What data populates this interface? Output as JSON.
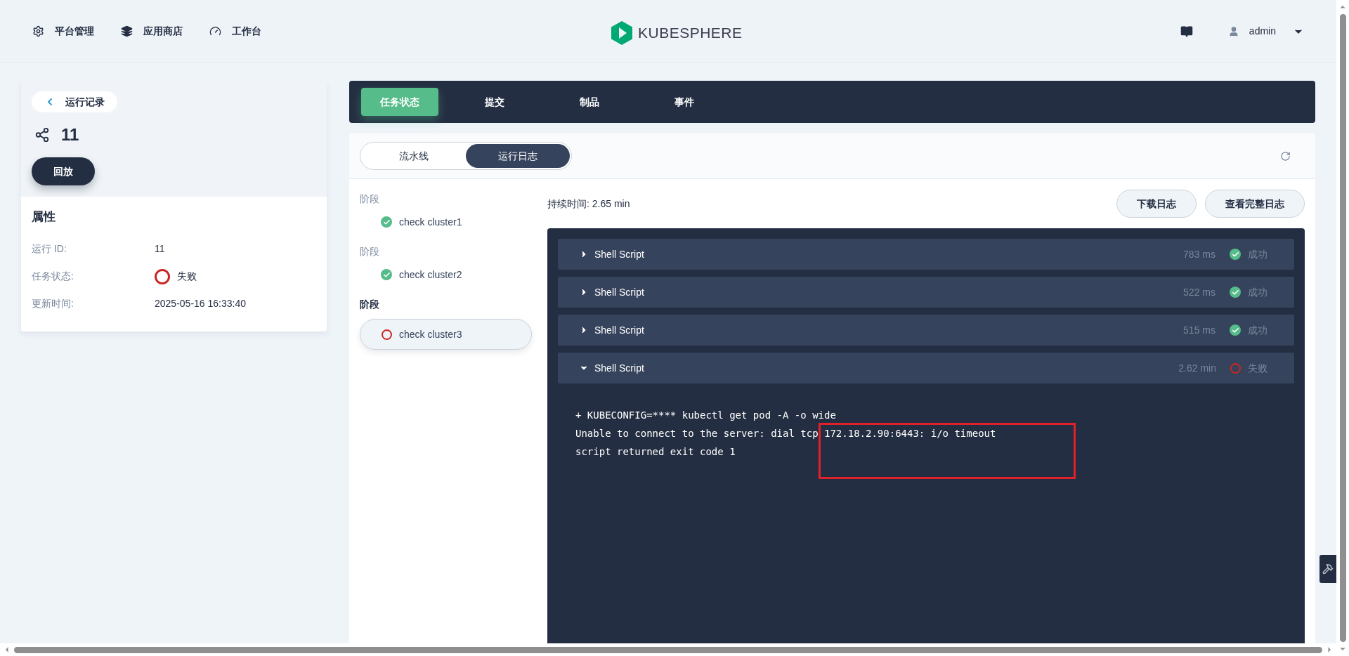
{
  "nav": [
    {
      "label": "平台管理",
      "kind": "gear"
    },
    {
      "label": "应用商店",
      "kind": "layers"
    },
    {
      "label": "工作台",
      "kind": "dial"
    }
  ],
  "logo": {
    "text": "KUBESPHERE"
  },
  "user": {
    "name": "admin"
  },
  "run_card": {
    "back_label": "运行记录",
    "run_number": "11",
    "replay_button": "回放",
    "section_title": "属性",
    "properties": [
      {
        "kind": "text",
        "label": "运行 ID:",
        "value": "11"
      },
      {
        "kind": "status",
        "label": "任务状态:",
        "value": "失败",
        "succeeded": false
      },
      {
        "kind": "text",
        "label": "更新时间:",
        "value": "2025-05-16 16:33:40"
      }
    ]
  },
  "tabs": [
    {
      "label": "任务状态",
      "selected": true
    },
    {
      "label": "提交",
      "selected": false
    },
    {
      "label": "制品",
      "selected": false
    },
    {
      "label": "事件",
      "selected": false
    }
  ],
  "view_toggle": [
    {
      "label": "流水线",
      "selected": false
    },
    {
      "label": "运行日志",
      "selected": true
    }
  ],
  "stages": [
    {
      "label": "阶段",
      "name": "check cluster1",
      "succeeded": true,
      "selected": false
    },
    {
      "label": "阶段",
      "name": "check cluster2",
      "succeeded": true,
      "selected": false
    },
    {
      "label": "阶段",
      "name": "check cluster3",
      "succeeded": false,
      "selected": true
    }
  ],
  "duration": {
    "label": "持续时间:",
    "value": "2.65 min"
  },
  "log_buttons": [
    "下载日志",
    "查看完整日志"
  ],
  "steps": [
    {
      "title": "Shell Script",
      "time": "783 ms",
      "result": "成功",
      "succeeded": true,
      "expanded": false
    },
    {
      "title": "Shell Script",
      "time": "522 ms",
      "result": "成功",
      "succeeded": true,
      "expanded": false
    },
    {
      "title": "Shell Script",
      "time": "515 ms",
      "result": "成功",
      "succeeded": true,
      "expanded": false
    },
    {
      "title": "Shell Script",
      "time": "2.62 min",
      "result": "失败",
      "succeeded": false,
      "expanded": true
    }
  ],
  "log_lines": [
    "+ KUBECONFIG=**** kubectl get pod -A -o wide",
    "Unable to connect to the server: dial tcp 172.18.2.90:6443: i/o timeout",
    "script returned exit code 1"
  ]
}
